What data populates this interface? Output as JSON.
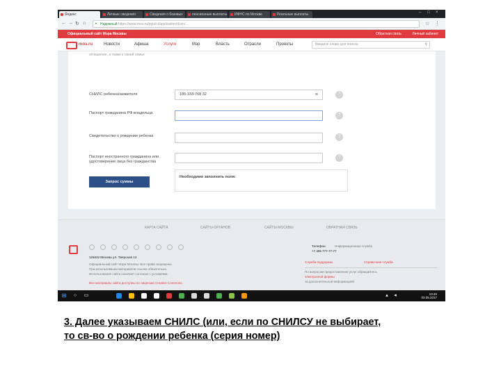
{
  "browser": {
    "tabs": [
      "Яндекс",
      "Личные сведения",
      "Сведения о базовых",
      "пенсионные выплаты",
      "ИФНС по Москве",
      "Реальные выплаты"
    ],
    "window_controls": [
      "–",
      "□",
      "×"
    ],
    "nav": [
      "←",
      "→",
      "↻",
      "⌂"
    ],
    "secure_label": "Надежный",
    "url": "https://www.mos.ru/pgu/ru/application/dszn/..."
  },
  "top_strip": {
    "official": "Официальный сайт Мэра Москвы",
    "links": [
      "Обратная связь",
      "Личный кабинет"
    ]
  },
  "site_nav": {
    "logo": "mos.ru",
    "items": [
      "Новости",
      "Афиша",
      "Услуги",
      "Мэр",
      "Власть",
      "Отрасли",
      "Проекты"
    ],
    "search_placeholder": "Введите слово для поиска"
  },
  "form": {
    "cut_text": "отношение, а также к своей семье",
    "fields": [
      {
        "label": "СНИЛС ребенка/заявителя",
        "value": "185-333-768 32"
      },
      {
        "label": "Паспорт гражданина РФ владельца",
        "value": ""
      },
      {
        "label": "Свидетельство о рождении ребенка",
        "value": ""
      },
      {
        "label": "Паспорт иностранного гражданина или удостоверение лица без гражданства",
        "value": ""
      }
    ],
    "help_glyph": "?",
    "submit_label": "Запрос суммы",
    "notice": "Необходимо заполнить поля:"
  },
  "footer": {
    "links": [
      "КАРТА САЙТА",
      "САЙТЫ ОРГАНОВ",
      "САЙТЫ МОСКВЫ",
      "ОБРАТНАЯ СВЯЗЬ"
    ],
    "address": "125032 Москва ул. Тверская 13",
    "text1": "Официальный сайт Мэра Москвы. Все права защищены.",
    "text2": "При использовании материалов ссылка обязательна.",
    "text3": "Использование сайта означает согласие с условиями.",
    "text4": "Все материалы сайта доступны по лицензии Creative Commons.",
    "phone_label": "Телефон",
    "phone": "+7 495 777-77-77",
    "right1": "Информационная служба",
    "right2": "Служба поддержки",
    "right3": "Справочная служба",
    "right4": "По вопросам предоставления услуг обращайтесь",
    "right5": "электронной формы",
    "right6": "за дополнительной информацией"
  },
  "taskbar": {
    "start_glyph": "⊞",
    "clock_time": "13:40",
    "clock_date": "03.05.2017"
  },
  "caption": {
    "line1": "3. Далее указываем СНИЛС (или, если по СНИЛСУ не выбирает,",
    "line2": "то св-во о рождении ребенка (серия номер)"
  }
}
